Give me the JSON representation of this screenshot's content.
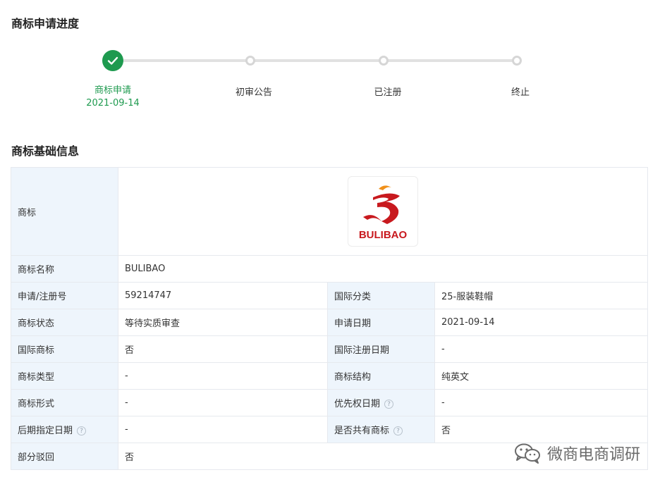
{
  "progress": {
    "title": "商标申请进度",
    "steps": [
      {
        "label": "商标申请",
        "date": "2021-09-14",
        "status": "done"
      },
      {
        "label": "初审公告",
        "date": "",
        "status": "pending"
      },
      {
        "label": "已注册",
        "date": "",
        "status": "pending"
      },
      {
        "label": "终止",
        "date": "",
        "status": "pending"
      }
    ]
  },
  "basic": {
    "title": "商标基础信息",
    "logo_label": "商标",
    "logo_text": "BULIBAO",
    "name_label": "商标名称",
    "name_value": "BULIBAO",
    "rows": [
      {
        "l1": "申请/注册号",
        "v1": "59214747",
        "l2": "国际分类",
        "v2": "25-服装鞋帽"
      },
      {
        "l1": "商标状态",
        "v1": "等待实质审查",
        "l2": "申请日期",
        "v2": "2021-09-14"
      },
      {
        "l1": "国际商标",
        "v1": "否",
        "l2": "国际注册日期",
        "v2": "-"
      },
      {
        "l1": "商标类型",
        "v1": "-",
        "l2": "商标结构",
        "v2": "纯英文"
      },
      {
        "l1": "商标形式",
        "v1": "-",
        "l2": "优先权日期",
        "v2": "-"
      },
      {
        "l1": "后期指定日期",
        "v1": "-",
        "l2": "是否共有商标",
        "v2": "否"
      }
    ],
    "last_label": "部分驳回",
    "last_value": "否",
    "help_glyph": "?"
  },
  "watermark": "微商电商调研",
  "colors": {
    "accent": "#1e9a4f",
    "label_bg": "#eef5fc",
    "logo_red": "#c8191e",
    "logo_orange": "#f0901a"
  }
}
